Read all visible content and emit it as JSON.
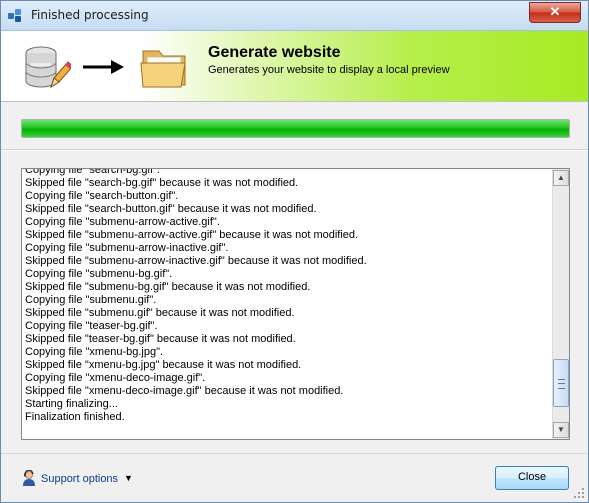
{
  "window": {
    "title": "Finished processing",
    "close_glyph": "✕"
  },
  "header": {
    "title": "Generate website",
    "subtitle": "Generates your website to display a local preview",
    "icons": [
      "database-edit-icon",
      "right-arrow-icon",
      "folder-icon"
    ]
  },
  "progress": {
    "value_percent": 100,
    "color": "#10b810"
  },
  "log": {
    "lines": [
      "Copying file \"search-bg.gif\".",
      "Skipped file \"search-bg.gif\" because it was not modified.",
      "Copying file \"search-button.gif\".",
      "Skipped file \"search-button.gif\" because it was not modified.",
      "Copying file \"submenu-arrow-active.gif\".",
      "Skipped file \"submenu-arrow-active.gif\" because it was not modified.",
      "Copying file \"submenu-arrow-inactive.gif\".",
      "Skipped file \"submenu-arrow-inactive.gif\" because it was not modified.",
      "Copying file \"submenu-bg.gif\".",
      "Skipped file \"submenu-bg.gif\" because it was not modified.",
      "Copying file \"submenu.gif\".",
      "Skipped file \"submenu.gif\" because it was not modified.",
      "Copying file \"teaser-bg.gif\".",
      "Skipped file \"teaser-bg.gif\" because it was not modified.",
      "Copying file \"xmenu-bg.jpg\".",
      "Skipped file \"xmenu-bg.jpg\" because it was not modified.",
      "Copying file \"xmenu-deco-image.gif\".",
      "Skipped file \"xmenu-deco-image.gif\" because it was not modified.",
      "Starting finalizing...",
      "Finalization finished."
    ]
  },
  "footer": {
    "support_label": "Support options",
    "support_caret": "▼",
    "close_label": "Close"
  }
}
